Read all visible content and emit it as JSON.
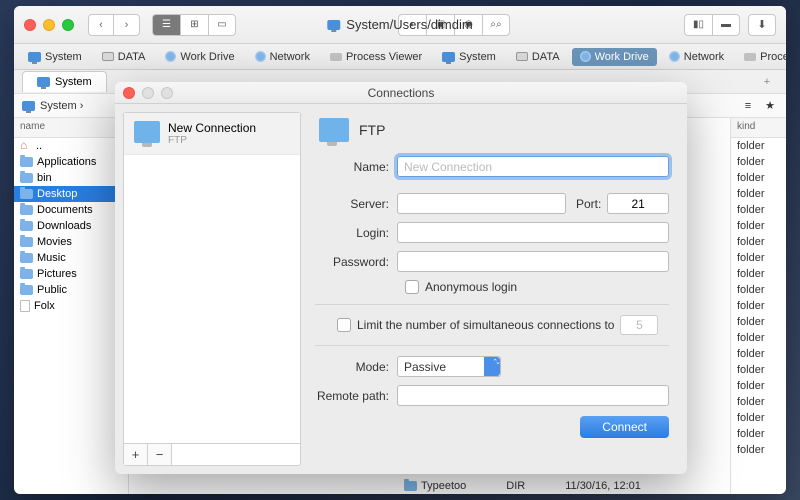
{
  "window": {
    "title": "System/Users/dimdim"
  },
  "tabbar1": [
    {
      "icon": "monitor",
      "label": "System",
      "active": false
    },
    {
      "icon": "drive",
      "label": "DATA"
    },
    {
      "icon": "net",
      "label": "Work Drive"
    },
    {
      "icon": "net",
      "label": "Network"
    },
    {
      "icon": "proc",
      "label": "Process Viewer"
    },
    {
      "icon": "monitor",
      "label": "System"
    },
    {
      "icon": "drive",
      "label": "DATA"
    },
    {
      "icon": "net",
      "label": "Work Drive",
      "active": true
    },
    {
      "icon": "net",
      "label": "Network"
    },
    {
      "icon": "proc",
      "label": "Process Viewer"
    }
  ],
  "tabbar2": {
    "label": "System"
  },
  "pathbar": {
    "left": "System ›"
  },
  "left_col": {
    "header": "name",
    "items": [
      {
        "icon": "home",
        "label": ".."
      },
      {
        "icon": "folder",
        "label": "Applications"
      },
      {
        "icon": "folder",
        "label": "bin"
      },
      {
        "icon": "folder",
        "label": "Desktop",
        "selected": true
      },
      {
        "icon": "folder",
        "label": "Documents"
      },
      {
        "icon": "folder",
        "label": "Downloads"
      },
      {
        "icon": "folder",
        "label": "Movies"
      },
      {
        "icon": "folder",
        "label": "Music"
      },
      {
        "icon": "folder",
        "label": "Pictures"
      },
      {
        "icon": "folder",
        "label": "Public"
      },
      {
        "icon": "file",
        "label": "Folx"
      }
    ]
  },
  "right_col": {
    "header": "kind",
    "rows": [
      "folder",
      "folder",
      "folder",
      "folder",
      "folder",
      "folder",
      "folder",
      "folder",
      "folder",
      "folder",
      "folder",
      "folder",
      "folder",
      "folder",
      "folder",
      "folder",
      "folder",
      "folder",
      "folder",
      "folder"
    ]
  },
  "modal": {
    "title": "Connections",
    "side_item": {
      "name": "New Connection",
      "sub": "FTP"
    },
    "header": "FTP",
    "labels": {
      "name": "Name:",
      "server": "Server:",
      "port": "Port:",
      "login": "Login:",
      "password": "Password:",
      "anon": "Anonymous login",
      "limit": "Limit the number of simultaneous connections to",
      "mode": "Mode:",
      "remote": "Remote path:"
    },
    "values": {
      "name_placeholder": "New Connection",
      "port": "21",
      "limit": "5",
      "mode": "Passive"
    },
    "connect": "Connect"
  },
  "bottom": {
    "file": "Typeetoo",
    "kind": "DIR",
    "date": "11/30/16, 12:01"
  }
}
